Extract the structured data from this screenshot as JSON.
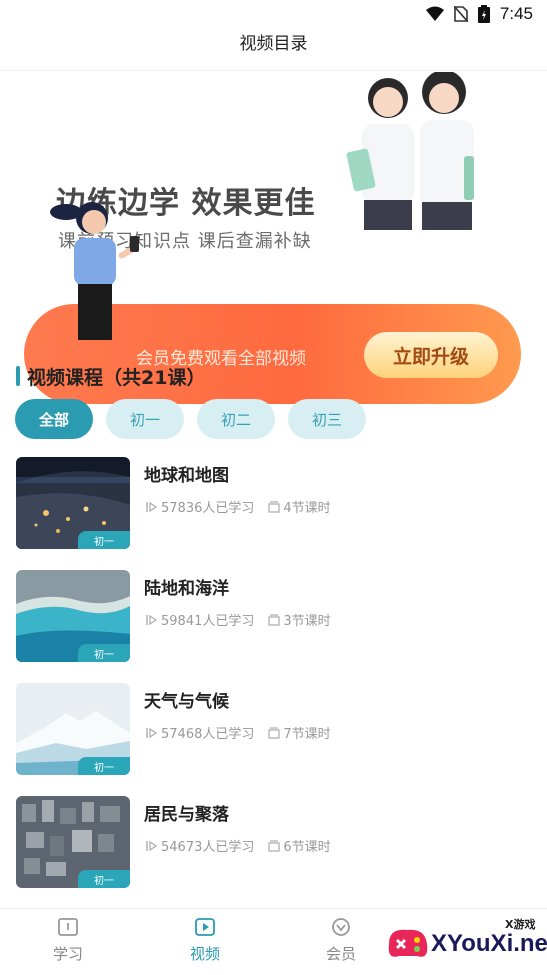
{
  "status_bar": {
    "time": "7:45"
  },
  "header": {
    "title": "视频目录"
  },
  "banner": {
    "headline": "边练边学 效果更佳",
    "subline": "课前预习知识点  课后查漏补缺",
    "promo_text": "会员免费观看全部视频",
    "upgrade_label": "立即升级",
    "colors": {
      "pill_start": "#ff7a4f",
      "pill_end": "#ff9a4e"
    }
  },
  "section": {
    "title": "视频课程（共21课）"
  },
  "filter_tabs": [
    {
      "label": "全部",
      "active": true
    },
    {
      "label": "初一",
      "active": false
    },
    {
      "label": "初二",
      "active": false
    },
    {
      "label": "初三",
      "active": false
    }
  ],
  "courses": [
    {
      "title": "地球和地图",
      "learners": "57836人已学习",
      "lessons": "4节课时",
      "level": "初一",
      "thumb": "earth-at-night"
    },
    {
      "title": "陆地和海洋",
      "learners": "59841人已学习",
      "lessons": "3节课时",
      "level": "初一",
      "thumb": "coastline"
    },
    {
      "title": "天气与气候",
      "learners": "57468人已学习",
      "lessons": "7节课时",
      "level": "初一",
      "thumb": "snow-mountain"
    },
    {
      "title": "居民与聚落",
      "learners": "54673人已学习",
      "lessons": "6节课时",
      "level": "初一",
      "thumb": "city-aerial"
    }
  ],
  "bottom_nav": [
    {
      "label": "学习",
      "icon": "book-icon",
      "active": false
    },
    {
      "label": "视频",
      "icon": "play-icon",
      "active": true
    },
    {
      "label": "会员",
      "icon": "vip-icon",
      "active": false
    }
  ],
  "watermark": {
    "text": "XYouXi.net",
    "small": "X游戏"
  },
  "colors": {
    "accent": "#2a9bb0",
    "tab_bg": "#d7eff2"
  }
}
